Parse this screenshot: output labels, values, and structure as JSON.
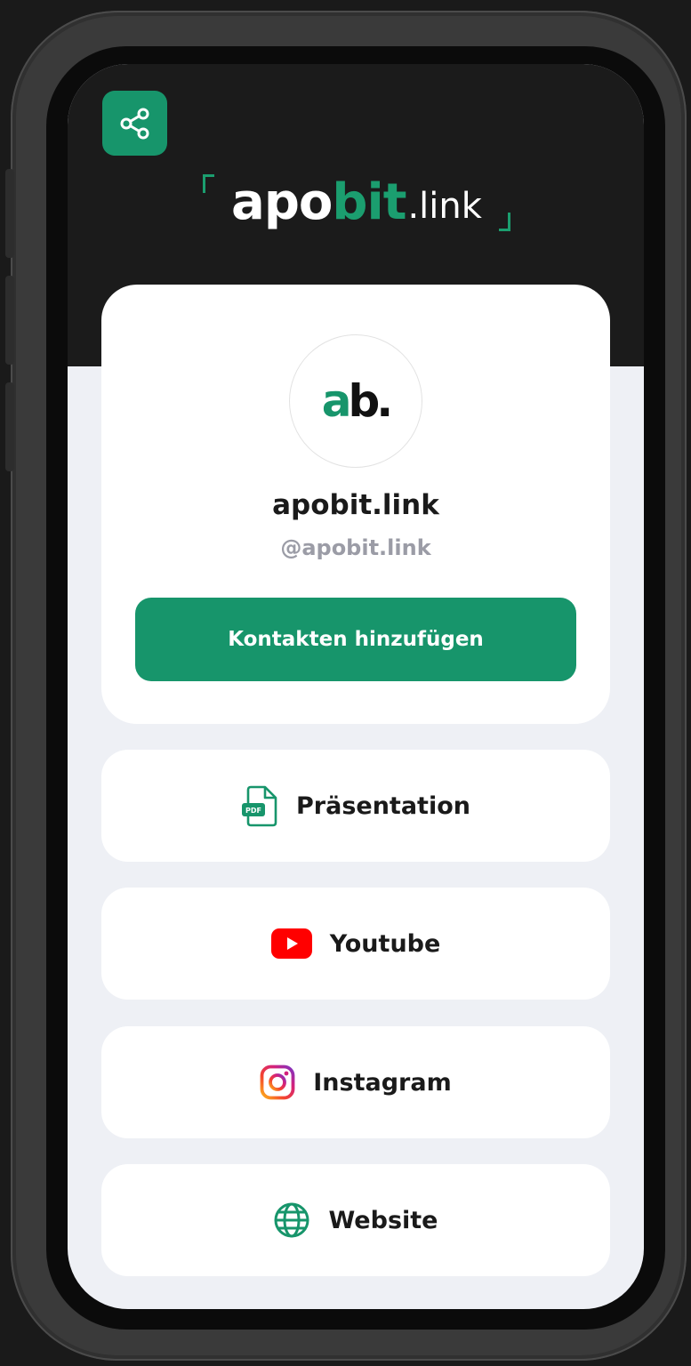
{
  "brand": {
    "logo_main": "apo",
    "logo_accent": "bit",
    "logo_tld": ".link",
    "accent_color": "#17956b"
  },
  "header": {
    "share_icon": "share-icon"
  },
  "profile": {
    "avatar_text_green": "a",
    "avatar_text_dark": "b.",
    "name": "apobit.link",
    "handle": "@apobit.link",
    "add_contacts_label": "Kontakten hinzufügen"
  },
  "links": [
    {
      "label": "Präsentation",
      "icon": "pdf-file-icon",
      "icon_text": "PDF"
    },
    {
      "label": "Youtube",
      "icon": "youtube-icon"
    },
    {
      "label": "Instagram",
      "icon": "instagram-icon"
    },
    {
      "label": "Website",
      "icon": "globe-icon"
    }
  ]
}
